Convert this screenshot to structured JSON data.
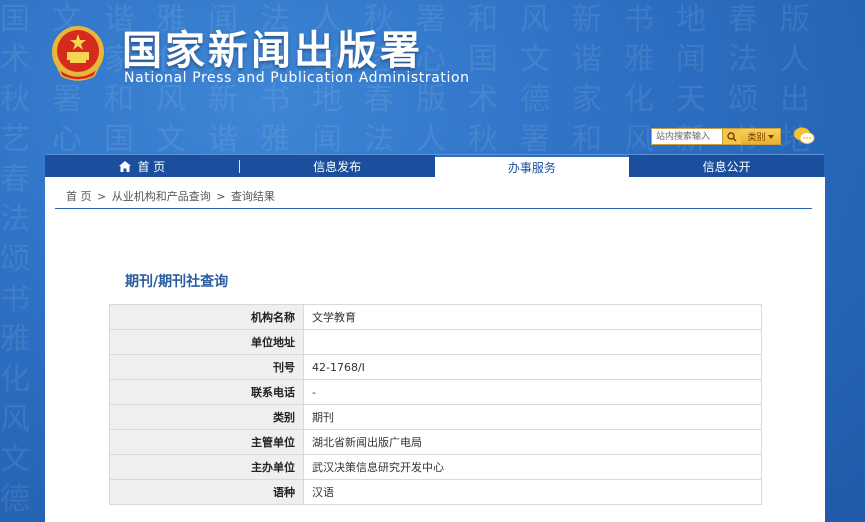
{
  "header": {
    "title_cn": "国家新闻出版署",
    "title_en": "National  Press and Publication Administration",
    "search_placeholder": "站内搜索输入",
    "category_label": "类别",
    "icons": {
      "emblem": "national-emblem-icon",
      "search": "search-icon",
      "chat": "chat-bubbles-icon",
      "dropdown": "caret-down-icon"
    }
  },
  "nav": {
    "items": [
      {
        "label": "首 页",
        "icon": "home-icon",
        "active": false
      },
      {
        "label": "信息发布",
        "active": false
      },
      {
        "label": "办事服务",
        "active": true
      },
      {
        "label": "信息公开",
        "active": false
      }
    ]
  },
  "breadcrumb": {
    "items": [
      "首 页",
      ">",
      "从业机构和产品查询",
      ">",
      "查询结果"
    ]
  },
  "page": {
    "title": "期刊/期刊社查询"
  },
  "table": {
    "rows": [
      {
        "label": "机构名称",
        "value": "文学教育"
      },
      {
        "label": "单位地址",
        "value": ""
      },
      {
        "label": "刊号",
        "value": "42-1768/I"
      },
      {
        "label": "联系电话",
        "value": "-"
      },
      {
        "label": "类别",
        "value": "期刊"
      },
      {
        "label": "主管单位",
        "value": "湖北省新闻出版广电局"
      },
      {
        "label": "主办单位",
        "value": "武汉决策信息研究开发中心"
      },
      {
        "label": "语种",
        "value": "汉语"
      }
    ]
  },
  "colors": {
    "nav_bg": "#1b4f9e",
    "title_text": "#2a5c9f",
    "label_cell_bg": "#efefef",
    "accent_gold": "#f3c64a"
  }
}
